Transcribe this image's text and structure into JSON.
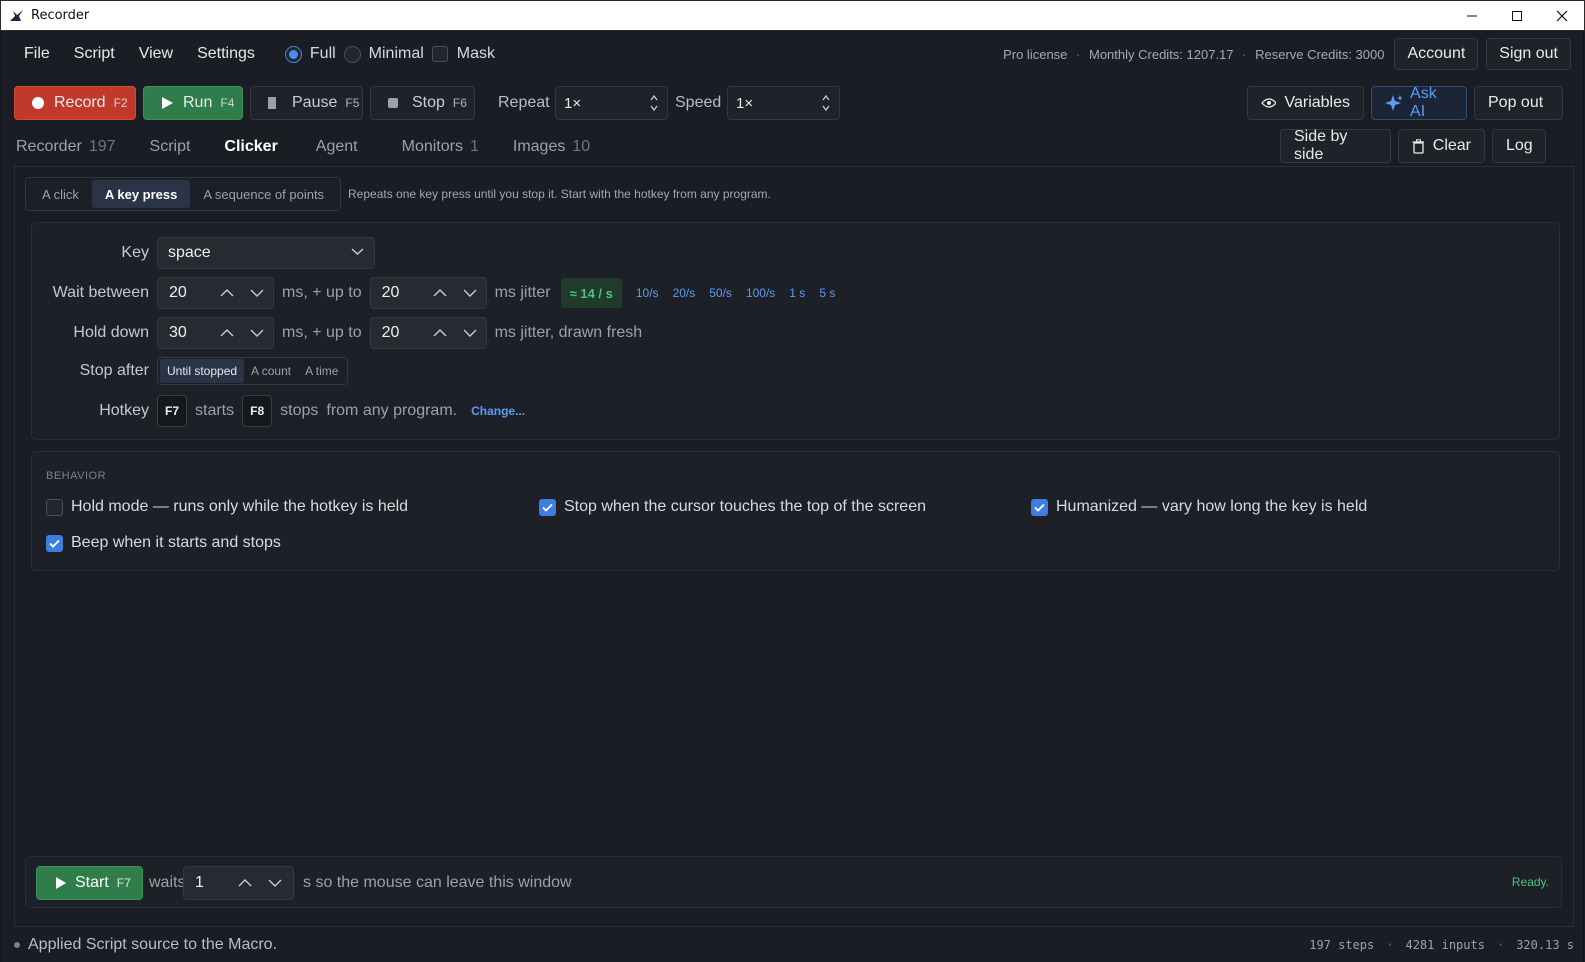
{
  "window": {
    "title": "Recorder"
  },
  "menu": {
    "file": "File",
    "script": "Script",
    "view": "View",
    "settings": "Settings"
  },
  "modes": [
    {
      "label": "Full",
      "selected": true
    },
    {
      "label": "Minimal",
      "selected": false
    },
    {
      "label": "Mask",
      "selected": false
    }
  ],
  "account": {
    "license": "Pro license",
    "monthly": "Monthly Credits: 1207.17",
    "reserve": "Reserve Credits: 3000",
    "account_label": "Account",
    "signout_label": "Sign out"
  },
  "toolbar": {
    "record": "Record",
    "record_key": "F2",
    "run": "Run",
    "run_key": "F4",
    "pause": "Pause",
    "pause_key": "F5",
    "stop": "Stop",
    "stop_key": "F6",
    "repeat_label": "Repeat",
    "repeat_value": "1×",
    "speed_label": "Speed",
    "speed_value": "1×",
    "variables": "Variables",
    "ask_ai": "Ask AI",
    "pop_out": "Pop out"
  },
  "tabs": [
    {
      "label": "Recorder",
      "count": "197"
    },
    {
      "label": "Script",
      "count": ""
    },
    {
      "label": "Clicker",
      "count": ""
    },
    {
      "label": "Agent",
      "count": ""
    },
    {
      "label": "Monitors",
      "count": "1"
    },
    {
      "label": "Images",
      "count": "10"
    }
  ],
  "tab_actions": {
    "side_by_side": "Side by side",
    "clear": "Clear",
    "log": "Log"
  },
  "clicker": {
    "mode_options": [
      "A click",
      "A key press",
      "A sequence of points"
    ],
    "mode_selected": "A key press",
    "description": "Repeats one key press until you stop it. Start with the hotkey from any program.",
    "key_label": "Key",
    "key_value": "space",
    "wait_label": "Wait between",
    "wait_value": "20",
    "wait_plus": "ms, + up to",
    "wait_jitter": "20",
    "wait_suffix": "ms jitter",
    "rate": "≈ 14 / s",
    "presets": [
      "10/s",
      "20/s",
      "50/s",
      "100/s",
      "1 s",
      "5 s"
    ],
    "hold_label": "Hold down",
    "hold_value": "30",
    "hold_plus": "ms, + up to",
    "hold_jitter": "20",
    "hold_suffix": "ms jitter, drawn fresh",
    "stop_label": "Stop after",
    "stop_options": [
      "Until stopped",
      "A count",
      "A time"
    ],
    "hotkey_label": "Hotkey",
    "hotkey_start": "F7",
    "starts": "starts",
    "hotkey_stop": "F8",
    "stops": "stops",
    "from_any": "from any program.",
    "change": "Change..."
  },
  "behavior": {
    "title": "BEHAVIOR",
    "options": [
      {
        "label": "Hold mode — runs only while the hotkey is held",
        "checked": false
      },
      {
        "label": "Stop when the cursor touches the top of the screen",
        "checked": true
      },
      {
        "label": "Humanized — vary how long the key is held",
        "checked": true
      },
      {
        "label": "Beep when it starts and stops",
        "checked": true
      }
    ]
  },
  "startbar": {
    "start": "Start",
    "start_key": "F7",
    "waits": "waits",
    "delay": "1",
    "suffix": "s so the mouse can leave this window",
    "status": "Ready."
  },
  "status": {
    "message": "Applied Script source to the Macro.",
    "steps": "197 steps",
    "inputs": "4281 inputs",
    "seconds": "320.13 s"
  },
  "colors": {
    "accent": "#4a8df0",
    "record": "#c0392b",
    "run": "#2f7d4a",
    "ready": "#4ec27a"
  }
}
